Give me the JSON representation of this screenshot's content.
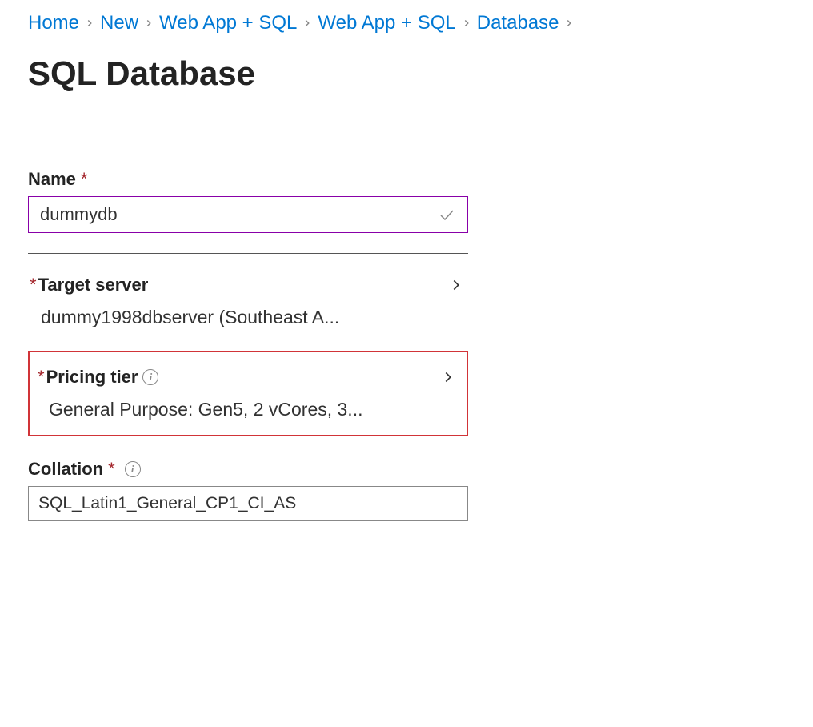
{
  "breadcrumb": {
    "items": [
      {
        "label": "Home"
      },
      {
        "label": "New"
      },
      {
        "label": "Web App + SQL"
      },
      {
        "label": "Web App + SQL"
      },
      {
        "label": "Database"
      }
    ]
  },
  "page": {
    "title": "SQL Database"
  },
  "form": {
    "name": {
      "label": "Name",
      "value": "dummydb"
    },
    "targetServer": {
      "label": "Target server",
      "value": "dummy1998dbserver (Southeast A..."
    },
    "pricingTier": {
      "label": "Pricing tier",
      "value": "General Purpose: Gen5, 2 vCores, 3..."
    },
    "collation": {
      "label": "Collation",
      "value": "SQL_Latin1_General_CP1_CI_AS"
    }
  }
}
